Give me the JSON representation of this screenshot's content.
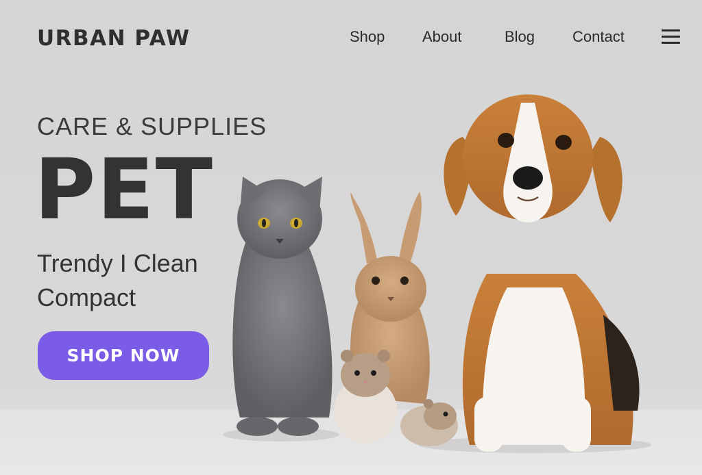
{
  "header": {
    "logo": "URBAN PAW",
    "nav": [
      {
        "label": "Shop"
      },
      {
        "label": "About"
      },
      {
        "label": "Blog"
      },
      {
        "label": "Contact"
      }
    ],
    "menu_icon": "hamburger-menu-icon"
  },
  "hero": {
    "kicker": "CARE & SUPPLIES",
    "headline": "PET",
    "tagline_1": "Trendy I Clean",
    "tagline_2": "Compact",
    "cta_label": "SHOP NOW"
  },
  "image": {
    "subjects": [
      "cat",
      "rabbit",
      "hamster",
      "hamster",
      "beagle"
    ]
  },
  "colors": {
    "accent": "#7b5ce6",
    "text": "#2e2e2e",
    "background": "#d7d6d6"
  }
}
